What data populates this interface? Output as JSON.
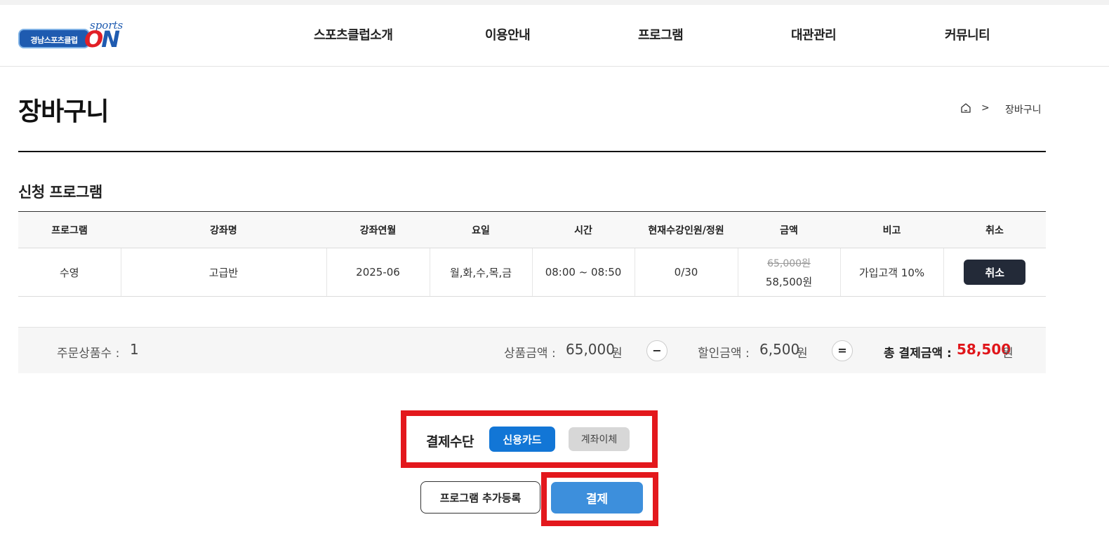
{
  "logo": {
    "badge_text": "경남스포츠클럽",
    "sports_text": "sports",
    "on_text_o": "O",
    "on_text_n": "N"
  },
  "nav": {
    "items": [
      {
        "label": "스포츠클럽소개"
      },
      {
        "label": "이용안내"
      },
      {
        "label": "프로그램"
      },
      {
        "label": "대관관리"
      },
      {
        "label": "커뮤니티"
      }
    ]
  },
  "page": {
    "title": "장바구니"
  },
  "breadcrumb": {
    "separator": ">",
    "current": "장바구니",
    "home_icon": "home-icon"
  },
  "section": {
    "title": "신청 프로그램"
  },
  "table": {
    "headers": [
      "프로그램",
      "강좌명",
      "강좌연월",
      "요일",
      "시간",
      "현재수강인원/정원",
      "금액",
      "비고",
      "취소"
    ],
    "rows": [
      {
        "program": "수영",
        "course": "고급반",
        "month": "2025-06",
        "days": "월,화,수,목,금",
        "time": "08:00 ~ 08:50",
        "enrollment": "0/30",
        "original_price": "65,000원",
        "price": "58,500원",
        "note": "가입고객 10%",
        "cancel_label": "취소"
      }
    ]
  },
  "summary": {
    "count_label": "주문상품수 :",
    "count_value": "1",
    "product_label": "상품금액 :",
    "product_value": "65,000",
    "minus": "−",
    "discount_label": "할인금액 :",
    "discount_value": "6,500",
    "equals": "=",
    "total_label": "총 결제금액 :",
    "total_value": "58,500",
    "unit": "원"
  },
  "payment": {
    "label": "결제수단",
    "options": [
      "신용카드",
      "계좌이체"
    ],
    "selected": "신용카드"
  },
  "actions": {
    "add_label": "프로그램 추가등록",
    "pay_label": "결제"
  },
  "colors": {
    "accent_blue": "#1276d6",
    "pay_button": "#3d8fdc",
    "highlight_red": "#e3181d",
    "total_red": "#e0161b",
    "dark_button": "#232a38"
  }
}
